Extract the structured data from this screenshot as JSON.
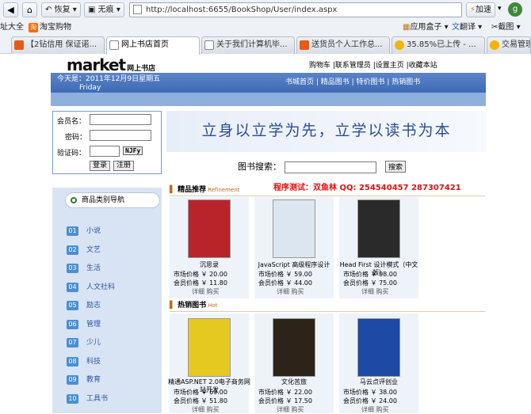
{
  "browser": {
    "nav_buttons": {
      "back": "恢复",
      "home": "无痕"
    },
    "url": "http://localhost:6655/BookShop/User/index.aspx",
    "accelerate": "加速",
    "bookmarks": [
      "址大全",
      "淘宝购物"
    ],
    "right_tools": [
      "应用盒子",
      "翻译",
      "截图"
    ],
    "tabs": [
      {
        "title": "【2钻信用 保证诺..."
      },
      {
        "title": "网上书店首页"
      },
      {
        "title": "关于我们计算机毕..."
      },
      {
        "title": "送货员个人工作总..."
      },
      {
        "title": "35.85%已上传 - ..."
      },
      {
        "title": "交易管理"
      }
    ]
  },
  "site": {
    "logo": "market",
    "logo_sub": "网上书店",
    "top_links": "购物车 |联系管理员 |设置主页 |收藏本站",
    "date_line1": "今天是：2011年12月9日星期五",
    "date_line2": "Friday",
    "nav": "书城首页  |  精品图书  |  特价图书  |  热销图书",
    "login": {
      "user_label": "会员名：",
      "pwd_label": "密码：",
      "code_label": "验证码：",
      "code": "NJFy",
      "login_btn": "登录",
      "register_btn": "注册"
    },
    "slogan": "立身以立学为先，立学以读书为本",
    "search": {
      "label": "图书搜索：",
      "button": "搜索"
    },
    "red_text": "程序测试：双鱼林          QQ: 254540457 287307421",
    "sidebar": {
      "title": "商品类别导航",
      "items": [
        {
          "num": "01",
          "label": "小说"
        },
        {
          "num": "02",
          "label": "文艺"
        },
        {
          "num": "03",
          "label": "生活"
        },
        {
          "num": "04",
          "label": "人文社科"
        },
        {
          "num": "05",
          "label": "励志"
        },
        {
          "num": "06",
          "label": "管理"
        },
        {
          "num": "07",
          "label": "少儿"
        },
        {
          "num": "08",
          "label": "科技"
        },
        {
          "num": "09",
          "label": "教育"
        },
        {
          "num": "10",
          "label": "工具书"
        }
      ]
    },
    "section1": {
      "title": "精品推荐",
      "en": "Refinement"
    },
    "section2": {
      "title": "热销图书",
      "en": "Hot"
    },
    "recommended": [
      {
        "title": "沉思录",
        "market": "市场价格  ￥  20.00",
        "member": "会员价格  ￥  11.80",
        "color": "#b8242a"
      },
      {
        "title": "JavaScript 高级程序设计",
        "market": "市场价格  ￥  59.00",
        "member": "会员价格  ￥  44.00",
        "color": "#dbe6f0"
      },
      {
        "title": "Head First 设计模式（中文版）",
        "market": "市场价格  ￥  98.00",
        "member": "会员价格  ￥  75.00",
        "color": "#2a2a2a"
      }
    ],
    "hot": [
      {
        "title": "精通ASP.NET 2.0电子商务网站开发",
        "market": "市场价格  ￥  69.00",
        "member": "会员价格  ￥  51.80",
        "color": "#e6c920"
      },
      {
        "title": "文化苦旅",
        "market": "市场价格  ￥  22.00",
        "member": "会员价格  ￥  17.50",
        "color": "#2c2418"
      },
      {
        "title": "马云点评创业",
        "market": "市场价格  ￥  38.00",
        "member": "会员价格  ￥  24.00",
        "color": "#1e4aa6"
      }
    ],
    "detail": "详细",
    "buy": "购买"
  }
}
